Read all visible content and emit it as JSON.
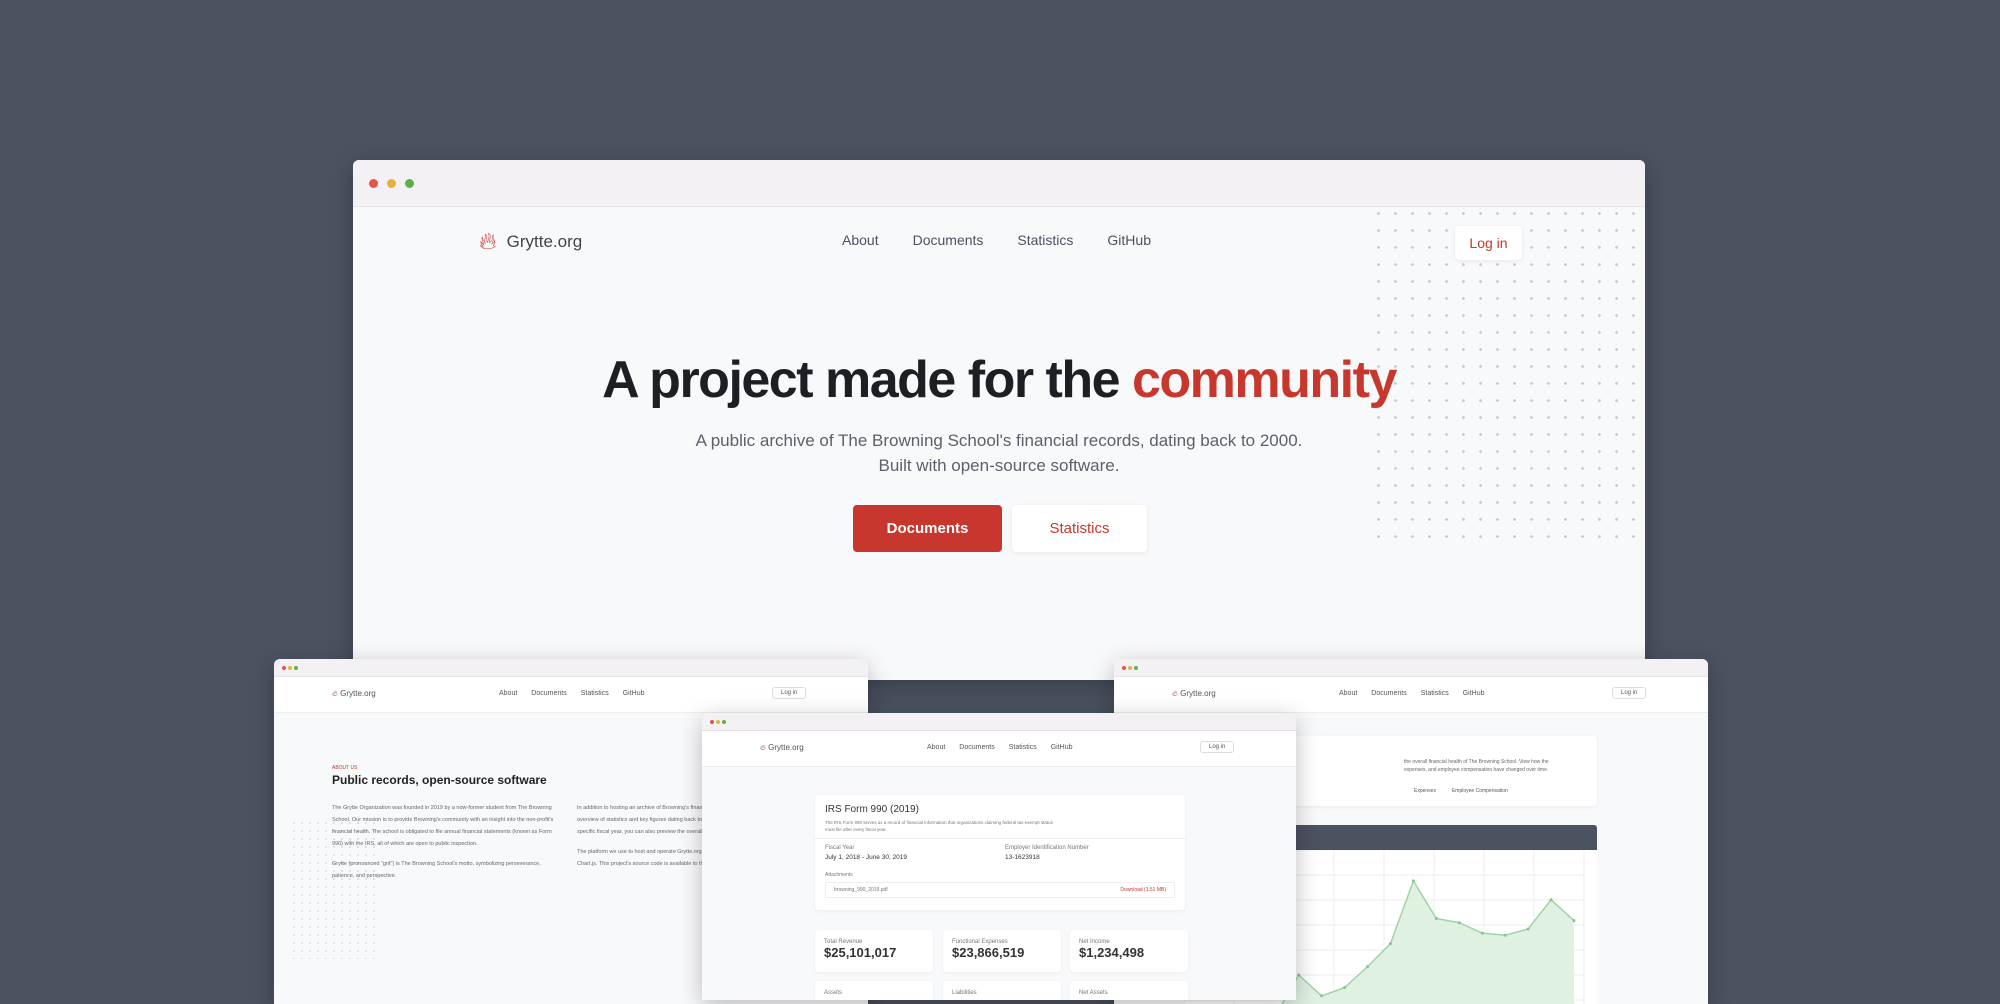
{
  "brand": {
    "name": "Grytte.org",
    "accent": "#c8372d",
    "background": "#4b5361"
  },
  "nav": {
    "items": [
      "About",
      "Documents",
      "Statistics",
      "GitHub"
    ],
    "login": "Log in"
  },
  "hero": {
    "title_part1": "A project made for the ",
    "title_highlight": "community",
    "subtitle_line1": "A public archive of The Browning School's financial records, dating back to 2000.",
    "subtitle_line2": "Built with open-source software.",
    "primary_button": "Documents",
    "secondary_button": "Statistics"
  },
  "about": {
    "eyebrow": "ABOUT US",
    "title": "Public records, open-source software",
    "p1": "The Grytte Organization was founded in 2019 by a now-former student from The Browning School. Our mission is to provide Browning's community with an insight into the non-profit's financial health. The school is obligated to file annual financial statements (known as Form 990) with the IRS, all of which are open to public inspection.",
    "p2": "Grytte (pronounced \"grit\") is The Browning School's motto, symbolizing perseverance, patience, and perspective.",
    "p3": "In addition to hosting an archive of Browning's financial records, we have compiled an overview of statistics and key figures dating back to the early 2000s. When analyzing a specific fiscal year, you can also preview the overall trend for that data point.",
    "p4": "The platform we use to host and operate Grytte.org is built with Laravel, Tailwind CSS, and Chart.js. This project's source code is available to the public on our GitHub."
  },
  "document": {
    "title": "IRS Form 990 (2019)",
    "description": "The IRS Form 990 serves as a record of financial information that organizations claiming federal tax-exempt status must file after every fiscal year.",
    "fiscal_year_label": "Fiscal Year",
    "fiscal_year": "July 1, 2018 - June 30, 2019",
    "ein_label": "Employer Identification Number",
    "ein": "13-1623918",
    "attachments_label": "Attachments",
    "attachment": "browning_990_2019.pdf",
    "download": "Download (1.51 MB)",
    "stats": [
      {
        "label": "Total Revenue",
        "value": "$25,101,017"
      },
      {
        "label": "Functional Expenses",
        "value": "$23,866,519"
      },
      {
        "label": "Net Income",
        "value": "$1,234,498"
      },
      {
        "label": "Assets",
        "value": ""
      },
      {
        "label": "Liabilities",
        "value": ""
      },
      {
        "label": "Net Assets",
        "value": ""
      }
    ]
  },
  "statistics": {
    "description_line1": "the overall financial health of The Browning School. View how the",
    "description_line2": "expenses, and employee compensation have changed over time.",
    "tabs": [
      "Expenses",
      "Employee Compensation"
    ]
  },
  "chart_data": {
    "type": "area",
    "title": "",
    "xlabel": "",
    "ylabel": "",
    "values": [
      22,
      27,
      27,
      34,
      36,
      55,
      45,
      49,
      59,
      70,
      100,
      82,
      80,
      75,
      74,
      77,
      91,
      81
    ],
    "ylim": [
      0,
      110
    ],
    "color": "#9fd3a7"
  }
}
